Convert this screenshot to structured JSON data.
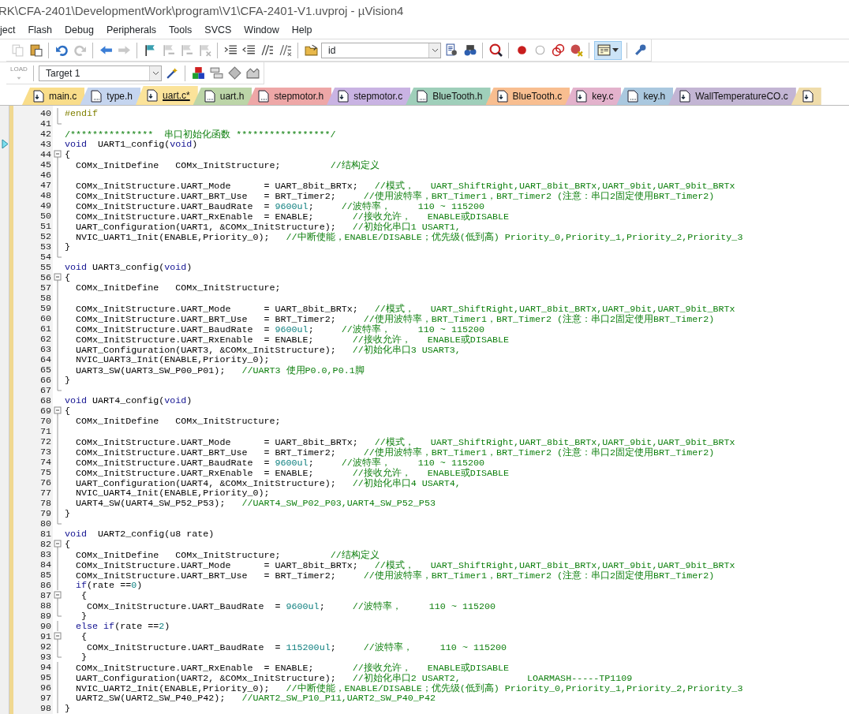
{
  "window": {
    "title": "RK\\CFA-2401\\DevelopmentWork\\program\\V1\\CFA-2401-V1.uvproj - µVision4"
  },
  "menu": [
    "ject",
    "Flash",
    "Debug",
    "Peripherals",
    "Tools",
    "SVCS",
    "Window",
    "Help"
  ],
  "toolbar": [
    {
      "kind": "copy",
      "disabled": true
    },
    {
      "kind": "paste",
      "disabled": false
    },
    {
      "kind": "separator"
    },
    {
      "kind": "undo",
      "disabled": false
    },
    {
      "kind": "redo",
      "disabled": true
    },
    {
      "kind": "separator"
    },
    {
      "kind": "back",
      "disabled": false
    },
    {
      "kind": "forward",
      "disabled": true
    },
    {
      "kind": "separator"
    },
    {
      "kind": "bookmark",
      "disabled": false
    },
    {
      "kind": "bookmark_prev",
      "disabled": true
    },
    {
      "kind": "bookmark_next",
      "disabled": true
    },
    {
      "kind": "bookmark_clear",
      "disabled": true
    },
    {
      "kind": "separator"
    },
    {
      "kind": "indent",
      "disabled": false
    },
    {
      "kind": "outdent",
      "disabled": false
    },
    {
      "kind": "comment",
      "disabled": false
    },
    {
      "kind": "uncomment",
      "disabled": false
    },
    {
      "kind": "separator"
    },
    {
      "kind": "open_folder",
      "disabled": false
    },
    {
      "kind": "find",
      "value": "id"
    },
    {
      "kind": "find_files",
      "disabled": false
    },
    {
      "kind": "binoculars",
      "disabled": false
    },
    {
      "kind": "separator"
    },
    {
      "kind": "debug",
      "disabled": false
    },
    {
      "kind": "separator"
    },
    {
      "kind": "breakpoint",
      "disabled": false
    },
    {
      "kind": "breakpoint_empty",
      "disabled": false
    },
    {
      "kind": "breakpoint_multi",
      "disabled": false
    },
    {
      "kind": "breakpoint_clear",
      "disabled": false
    },
    {
      "kind": "separator"
    },
    {
      "kind": "window_layout",
      "selected": true
    },
    {
      "kind": "separator"
    },
    {
      "kind": "wrench",
      "disabled": false
    }
  ],
  "build_toolbar": [
    {
      "kind": "load",
      "label": "LOAD",
      "disabled": true
    },
    {
      "kind": "separator"
    },
    {
      "kind": "target",
      "value": "Target 1"
    },
    {
      "kind": "wand",
      "disabled": false
    },
    {
      "kind": "separator"
    },
    {
      "kind": "blocks",
      "disabled": false
    },
    {
      "kind": "stack",
      "disabled": false
    },
    {
      "kind": "diamond",
      "disabled": false
    },
    {
      "kind": "books",
      "disabled": false
    }
  ],
  "tabs": [
    {
      "label": "main.c",
      "kind": "source",
      "color": "#f9dd8a",
      "selected": false
    },
    {
      "label": "type.h",
      "kind": "header",
      "color": "#c5d5ef",
      "selected": false
    },
    {
      "label": "uart.c*",
      "kind": "source",
      "color": "#fbe39a",
      "selected": true
    },
    {
      "label": "uart.h",
      "kind": "header",
      "color": "#bcd5a8",
      "selected": false
    },
    {
      "label": "stepmotor.h",
      "kind": "header",
      "color": "#eea7a7",
      "selected": false
    },
    {
      "label": "stepmotor.c",
      "kind": "source",
      "color": "#c9b3e3",
      "selected": false
    },
    {
      "label": "BlueTooth.h",
      "kind": "header",
      "color": "#9fcfba",
      "selected": false
    },
    {
      "label": "BlueTooth.c",
      "kind": "source",
      "color": "#f8be90",
      "selected": false
    },
    {
      "label": "key.c",
      "kind": "source",
      "color": "#e3b2cc",
      "selected": false
    },
    {
      "label": "key.h",
      "kind": "header",
      "color": "#aac8df",
      "selected": false
    },
    {
      "label": "WallTemperatureCO.c",
      "kind": "source",
      "color": "#c3b5d4",
      "selected": false
    },
    {
      "kind": "source",
      "color": "#efdcaa",
      "selected": false
    }
  ],
  "editor": {
    "lines": [
      {
        "number": "40",
        "current": false,
        "kind": "fold_body",
        "segments": [
          {
            "kind": "preproc",
            "text": "#endif"
          }
        ]
      },
      {
        "number": "41",
        "current": false,
        "kind": "fold_end"
      },
      {
        "number": "42",
        "current": false,
        "kind": "plain",
        "segments": [
          {
            "kind": "comment",
            "text": "/***************  串口初始化函数 *****************/"
          }
        ]
      },
      {
        "number": "43",
        "current": true,
        "kind": "plain",
        "segments": [
          {
            "kind": "keyword",
            "text": "void"
          },
          {
            "kind": "plain",
            "text": "  UART1_config("
          },
          {
            "kind": "keyword",
            "text": "void"
          },
          {
            "kind": "plain",
            "text": ")"
          }
        ]
      },
      {
        "number": "44",
        "current": false,
        "kind": "fold_start",
        "segments": [
          {
            "kind": "plain",
            "text": "{"
          }
        ]
      },
      {
        "number": "45",
        "current": false,
        "kind": "fold_body",
        "segments": [
          {
            "kind": "plain",
            "text": "  COMx_InitDefine   COMx_InitStructure;         "
          },
          {
            "kind": "comment",
            "text": "//结构定义"
          }
        ]
      },
      {
        "number": "46",
        "current": false,
        "kind": "fold_body"
      },
      {
        "number": "47",
        "current": false,
        "kind": "fold_body",
        "segments": [
          {
            "kind": "plain",
            "text": "  COMx_InitStructure.UART_Mode      = UART_8bit_BRTx;   "
          },
          {
            "kind": "comment",
            "text": "//模式，   UART_ShiftRight,UART_8bit_BRTx,UART_9bit,UART_9bit_BRTx"
          }
        ]
      },
      {
        "number": "48",
        "current": false,
        "kind": "fold_body",
        "segments": [
          {
            "kind": "plain",
            "text": "  COMx_InitStructure.UART_BRT_Use   = BRT_Timer2;     "
          },
          {
            "kind": "comment",
            "text": "//使用波特率，BRT_Timer1，BRT_Timer2 (注意：串口2固定使用BRT_Timer2)"
          }
        ]
      },
      {
        "number": "49",
        "current": false,
        "kind": "fold_body",
        "segments": [
          {
            "kind": "plain",
            "text": "  COMx_InitStructure.UART_BaudRate  = "
          },
          {
            "kind": "number",
            "text": "9600ul"
          },
          {
            "kind": "plain",
            "text": ";     "
          },
          {
            "kind": "comment",
            "text": "//波特率，     110 ~ 115200"
          }
        ]
      },
      {
        "number": "50",
        "current": false,
        "kind": "fold_body",
        "segments": [
          {
            "kind": "plain",
            "text": "  COMx_InitStructure.UART_RxEnable  = ENABLE;       "
          },
          {
            "kind": "comment",
            "text": "//接收允许，   ENABLE或DISABLE"
          }
        ]
      },
      {
        "number": "51",
        "current": false,
        "kind": "fold_body",
        "segments": [
          {
            "kind": "plain",
            "text": "  UART_Configuration(UART1, &COMx_InitStructure);   "
          },
          {
            "kind": "comment",
            "text": "//初始化串口1 USART1,"
          }
        ]
      },
      {
        "number": "52",
        "current": false,
        "kind": "fold_body",
        "segments": [
          {
            "kind": "plain",
            "text": "  NVIC_UART1_Init(ENABLE,Priority_0);   "
          },
          {
            "kind": "comment",
            "text": "//中断使能，ENABLE/DISABLE；优先级(低到高) Priority_0,Priority_1,Priority_2,Priority_3"
          }
        ]
      },
      {
        "number": "53",
        "current": false,
        "kind": "fold_body",
        "segments": [
          {
            "kind": "plain",
            "text": "}"
          }
        ]
      },
      {
        "number": "54",
        "current": false,
        "kind": "fold_end"
      },
      {
        "number": "55",
        "current": false,
        "kind": "plain",
        "segments": [
          {
            "kind": "keyword",
            "text": "void"
          },
          {
            "kind": "plain",
            "text": " UART3_config("
          },
          {
            "kind": "keyword",
            "text": "void"
          },
          {
            "kind": "plain",
            "text": ")"
          }
        ]
      },
      {
        "number": "56",
        "current": false,
        "kind": "fold_start",
        "segments": [
          {
            "kind": "plain",
            "text": "{"
          }
        ]
      },
      {
        "number": "57",
        "current": false,
        "kind": "fold_body",
        "segments": [
          {
            "kind": "plain",
            "text": "  COMx_InitDefine   COMx_InitStructure;"
          }
        ]
      },
      {
        "number": "58",
        "current": false,
        "kind": "fold_body"
      },
      {
        "number": "59",
        "current": false,
        "kind": "fold_body",
        "segments": [
          {
            "kind": "plain",
            "text": "  COMx_InitStructure.UART_Mode      = UART_8bit_BRTx;   "
          },
          {
            "kind": "comment",
            "text": "//模式，   UART_ShiftRight,UART_8bit_BRTx,UART_9bit,UART_9bit_BRTx"
          }
        ]
      },
      {
        "number": "60",
        "current": false,
        "kind": "fold_body",
        "segments": [
          {
            "kind": "plain",
            "text": "  COMx_InitStructure.UART_BRT_Use   = BRT_Timer2;     "
          },
          {
            "kind": "comment",
            "text": "//使用波特率，BRT_Timer1，BRT_Timer2 (注意：串口2固定使用BRT_Timer2)"
          }
        ]
      },
      {
        "number": "61",
        "current": false,
        "kind": "fold_body",
        "segments": [
          {
            "kind": "plain",
            "text": "  COMx_InitStructure.UART_BaudRate  = "
          },
          {
            "kind": "number",
            "text": "9600ul"
          },
          {
            "kind": "plain",
            "text": ";     "
          },
          {
            "kind": "comment",
            "text": "//波特率，     110 ~ 115200"
          }
        ]
      },
      {
        "number": "62",
        "current": false,
        "kind": "fold_body",
        "segments": [
          {
            "kind": "plain",
            "text": "  COMx_InitStructure.UART_RxEnable  = ENABLE;       "
          },
          {
            "kind": "comment",
            "text": "//接收允许，   ENABLE或DISABLE"
          }
        ]
      },
      {
        "number": "63",
        "current": false,
        "kind": "fold_body",
        "segments": [
          {
            "kind": "plain",
            "text": "  UART_Configuration(UART3, &COMx_InitStructure);   "
          },
          {
            "kind": "comment",
            "text": "//初始化串口3 USART3,"
          }
        ]
      },
      {
        "number": "64",
        "current": false,
        "kind": "fold_body",
        "segments": [
          {
            "kind": "plain",
            "text": "  NVIC_UART3_Init(ENABLE,Priority_0);"
          }
        ]
      },
      {
        "number": "65",
        "current": false,
        "kind": "fold_body",
        "segments": [
          {
            "kind": "plain",
            "text": "  UART3_SW(UART3_SW_P00_P01);   "
          },
          {
            "kind": "comment",
            "text": "//UART3 使用P0.0,P0.1脚"
          }
        ]
      },
      {
        "number": "66",
        "current": false,
        "kind": "fold_body",
        "segments": [
          {
            "kind": "plain",
            "text": "}"
          }
        ]
      },
      {
        "number": "67",
        "current": false,
        "kind": "fold_end"
      },
      {
        "number": "68",
        "current": false,
        "kind": "plain",
        "segments": [
          {
            "kind": "keyword",
            "text": "void"
          },
          {
            "kind": "plain",
            "text": " UART4_config("
          },
          {
            "kind": "keyword",
            "text": "void"
          },
          {
            "kind": "plain",
            "text": ")"
          }
        ]
      },
      {
        "number": "69",
        "current": false,
        "kind": "fold_start",
        "segments": [
          {
            "kind": "plain",
            "text": "{"
          }
        ]
      },
      {
        "number": "70",
        "current": false,
        "kind": "fold_body",
        "segments": [
          {
            "kind": "plain",
            "text": "  COMx_InitDefine   COMx_InitStructure;"
          }
        ]
      },
      {
        "number": "71",
        "current": false,
        "kind": "fold_body"
      },
      {
        "number": "72",
        "current": false,
        "kind": "fold_body",
        "segments": [
          {
            "kind": "plain",
            "text": "  COMx_InitStructure.UART_Mode      = UART_8bit_BRTx;   "
          },
          {
            "kind": "comment",
            "text": "//模式，   UART_ShiftRight,UART_8bit_BRTx,UART_9bit,UART_9bit_BRTx"
          }
        ]
      },
      {
        "number": "73",
        "current": false,
        "kind": "fold_body",
        "segments": [
          {
            "kind": "plain",
            "text": "  COMx_InitStructure.UART_BRT_Use   = BRT_Timer2;     "
          },
          {
            "kind": "comment",
            "text": "//使用波特率，BRT_Timer1，BRT_Timer2 (注意：串口2固定使用BRT_Timer2)"
          }
        ]
      },
      {
        "number": "74",
        "current": false,
        "kind": "fold_body",
        "segments": [
          {
            "kind": "plain",
            "text": "  COMx_InitStructure.UART_BaudRate  = "
          },
          {
            "kind": "number",
            "text": "9600ul"
          },
          {
            "kind": "plain",
            "text": ";     "
          },
          {
            "kind": "comment",
            "text": "//波特率，     110 ~ 115200"
          }
        ]
      },
      {
        "number": "75",
        "current": false,
        "kind": "fold_body",
        "segments": [
          {
            "kind": "plain",
            "text": "  COMx_InitStructure.UART_RxEnable  = ENABLE;       "
          },
          {
            "kind": "comment",
            "text": "//接收允许，   ENABLE或DISABLE"
          }
        ]
      },
      {
        "number": "76",
        "current": false,
        "kind": "fold_body",
        "segments": [
          {
            "kind": "plain",
            "text": "  UART_Configuration(UART4, &COMx_InitStructure);   "
          },
          {
            "kind": "comment",
            "text": "//初始化串口4 USART4,"
          }
        ]
      },
      {
        "number": "77",
        "current": false,
        "kind": "fold_body",
        "segments": [
          {
            "kind": "plain",
            "text": "  NVIC_UART4_Init(ENABLE,Priority_0);"
          }
        ]
      },
      {
        "number": "78",
        "current": false,
        "kind": "fold_body",
        "segments": [
          {
            "kind": "plain",
            "text": "  UART4_SW(UART4_SW_P52_P53);   "
          },
          {
            "kind": "comment",
            "text": "//UART4_SW_P02_P03,UART4_SW_P52_P53"
          }
        ]
      },
      {
        "number": "79",
        "current": false,
        "kind": "fold_body",
        "segments": [
          {
            "kind": "plain",
            "text": "}"
          }
        ]
      },
      {
        "number": "80",
        "current": false,
        "kind": "fold_end"
      },
      {
        "number": "81",
        "current": false,
        "kind": "plain",
        "segments": [
          {
            "kind": "keyword",
            "text": "void"
          },
          {
            "kind": "plain",
            "text": "  UART2_config(u8 rate)"
          }
        ]
      },
      {
        "number": "82",
        "current": false,
        "kind": "fold_start",
        "segments": [
          {
            "kind": "plain",
            "text": "{"
          }
        ]
      },
      {
        "number": "83",
        "current": false,
        "kind": "fold_body",
        "segments": [
          {
            "kind": "plain",
            "text": "  COMx_InitDefine   COMx_InitStructure;         "
          },
          {
            "kind": "comment",
            "text": "//结构定义"
          }
        ]
      },
      {
        "number": "84",
        "current": false,
        "kind": "fold_body",
        "segments": [
          {
            "kind": "plain",
            "text": "  COMx_InitStructure.UART_Mode      = UART_8bit_BRTx;   "
          },
          {
            "kind": "comment",
            "text": "//模式，   UART_ShiftRight,UART_8bit_BRTx,UART_9bit,UART_9bit_BRTx"
          }
        ]
      },
      {
        "number": "85",
        "current": false,
        "kind": "fold_body",
        "segments": [
          {
            "kind": "plain",
            "text": "  COMx_InitStructure.UART_BRT_Use   = BRT_Timer2;     "
          },
          {
            "kind": "comment",
            "text": "//使用波特率，BRT_Timer1，BRT_Timer2 (注意：串口2固定使用BRT_Timer2)"
          }
        ]
      },
      {
        "number": "86",
        "current": false,
        "kind": "fold_body",
        "segments": [
          {
            "kind": "keyword",
            "text": "  if"
          },
          {
            "kind": "plain",
            "text": "(rate =="
          },
          {
            "kind": "number",
            "text": "0"
          },
          {
            "kind": "plain",
            "text": ")"
          }
        ]
      },
      {
        "number": "87",
        "current": false,
        "kind": "fold_start",
        "segments": [
          {
            "kind": "plain",
            "text": "   {"
          }
        ]
      },
      {
        "number": "88",
        "current": false,
        "kind": "fold_body",
        "segments": [
          {
            "kind": "plain",
            "text": "    COMx_InitStructure.UART_BaudRate  = "
          },
          {
            "kind": "number",
            "text": "9600ul"
          },
          {
            "kind": "plain",
            "text": ";     "
          },
          {
            "kind": "comment",
            "text": "//波特率，     110 ~ 115200"
          }
        ]
      },
      {
        "number": "89",
        "current": false,
        "kind": "fold_end",
        "segments": [
          {
            "kind": "plain",
            "text": "   }"
          }
        ]
      },
      {
        "number": "90",
        "current": false,
        "kind": "fold_body",
        "segments": [
          {
            "kind": "keyword",
            "text": "  else if"
          },
          {
            "kind": "plain",
            "text": "(rate =="
          },
          {
            "kind": "number",
            "text": "2"
          },
          {
            "kind": "plain",
            "text": ")"
          }
        ]
      },
      {
        "number": "91",
        "current": false,
        "kind": "fold_start",
        "segments": [
          {
            "kind": "plain",
            "text": "   {"
          }
        ]
      },
      {
        "number": "92",
        "current": false,
        "kind": "fold_body",
        "segments": [
          {
            "kind": "plain",
            "text": "    COMx_InitStructure.UART_BaudRate  = "
          },
          {
            "kind": "number",
            "text": "115200ul"
          },
          {
            "kind": "plain",
            "text": ";     "
          },
          {
            "kind": "comment",
            "text": "//波特率，     110 ~ 115200"
          }
        ]
      },
      {
        "number": "93",
        "current": false,
        "kind": "fold_end",
        "segments": [
          {
            "kind": "plain",
            "text": "   }"
          }
        ]
      },
      {
        "number": "94",
        "current": false,
        "kind": "fold_body",
        "segments": [
          {
            "kind": "plain",
            "text": "  COMx_InitStructure.UART_RxEnable  = ENABLE;       "
          },
          {
            "kind": "comment",
            "text": "//接收允许，   ENABLE或DISABLE"
          }
        ]
      },
      {
        "number": "95",
        "current": false,
        "kind": "fold_body",
        "segments": [
          {
            "kind": "plain",
            "text": "  UART_Configuration(UART2, &COMx_InitStructure);   "
          },
          {
            "kind": "comment",
            "text": "//初始化串口2 USART2,            LOARMASH-----TP1109"
          }
        ]
      },
      {
        "number": "96",
        "current": false,
        "kind": "fold_body",
        "segments": [
          {
            "kind": "plain",
            "text": "  NVIC_UART2_Init(ENABLE,Priority_0);   "
          },
          {
            "kind": "comment",
            "text": "//中断使能，ENABLE/DISABLE；优先级(低到高) Priority_0,Priority_1,Priority_2,Priority_3"
          }
        ]
      },
      {
        "number": "97",
        "current": false,
        "kind": "fold_body",
        "segments": [
          {
            "kind": "plain",
            "text": "  UART2_SW(UART2_SW_P40_P42);   "
          },
          {
            "kind": "comment",
            "text": "//UART2_SW_P10_P11,UART2_SW_P40_P42"
          }
        ]
      },
      {
        "number": "98",
        "current": false,
        "kind": "fold_body",
        "segments": [
          {
            "kind": "plain",
            "text": "}"
          }
        ]
      }
    ]
  }
}
